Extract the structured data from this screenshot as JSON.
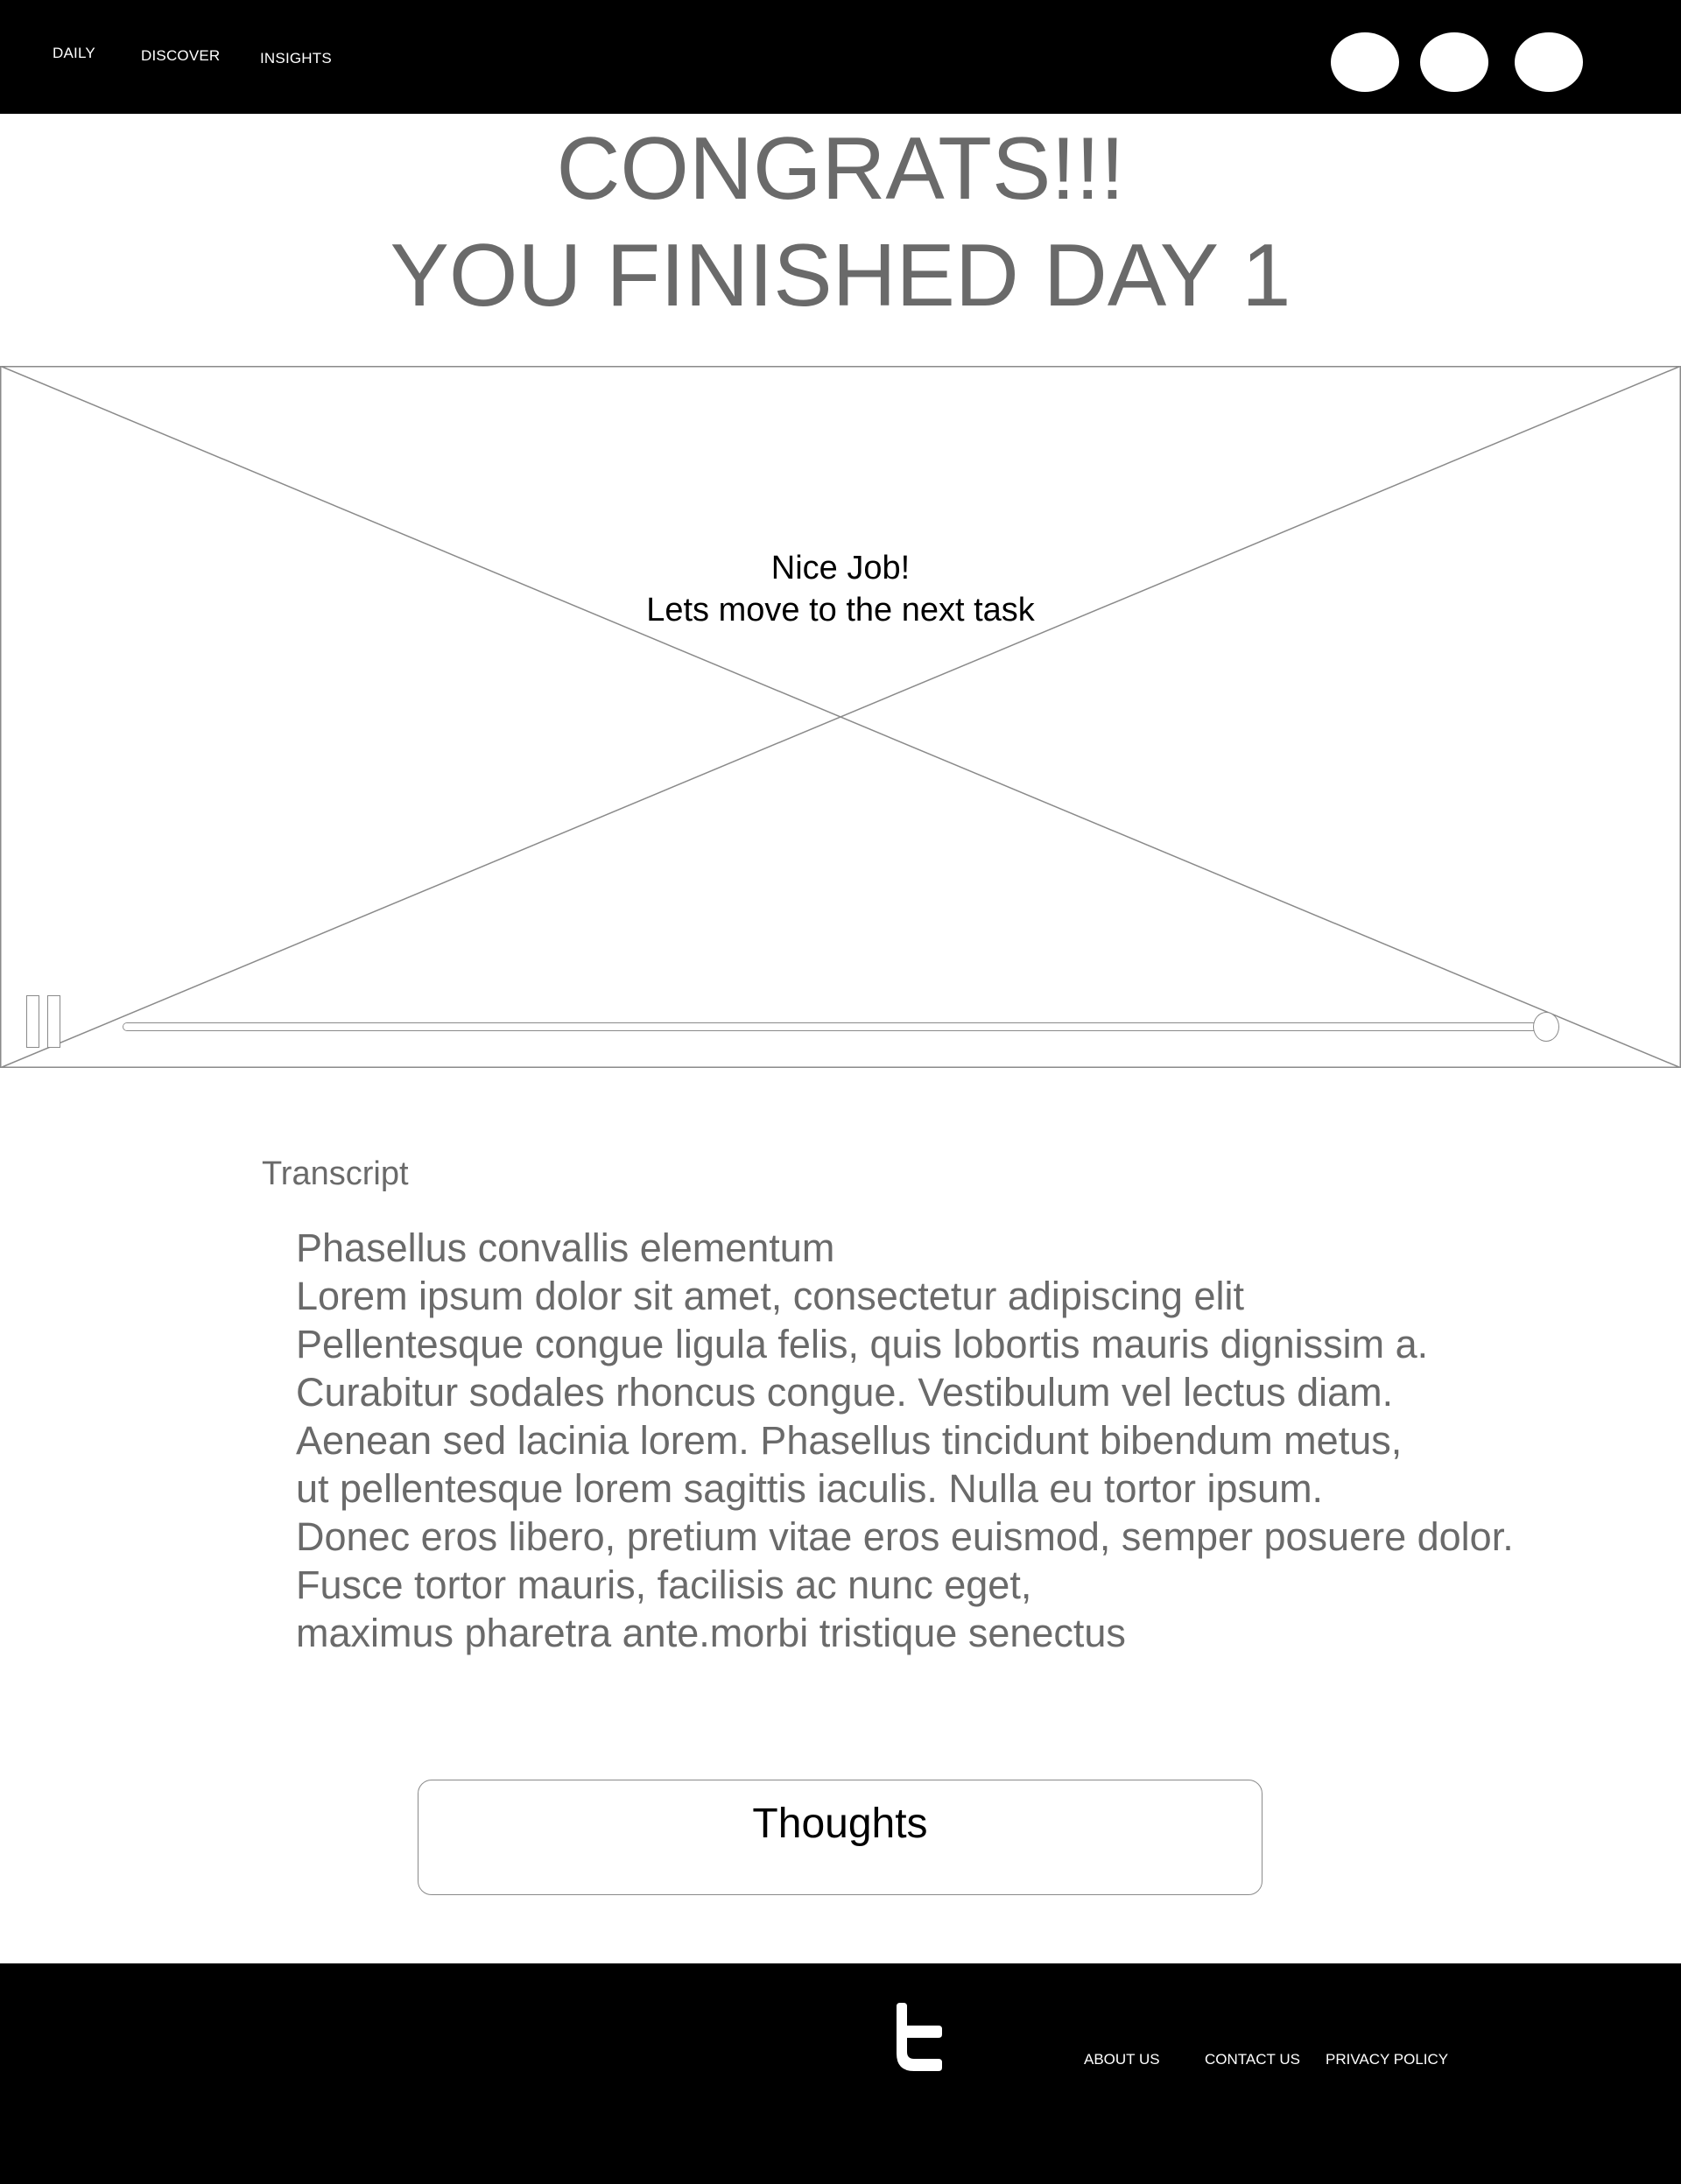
{
  "nav": {
    "items": [
      {
        "label": "DAILY"
      },
      {
        "label": "DISCOVER"
      },
      {
        "label": "INSIGHTS"
      }
    ]
  },
  "headline": {
    "line1": "CONGRATS!!!",
    "line2": "YOU FINISHED DAY 1"
  },
  "video": {
    "message_line1": "Nice Job!",
    "message_line2": "Lets move to the next task",
    "progress": 1.0,
    "state": "playing"
  },
  "transcript": {
    "heading": "Transcript",
    "lines": [
      "Phasellus convallis elementum",
      "Lorem ipsum dolor sit amet, consectetur adipiscing elit",
      "Pellentesque congue ligula felis, quis lobortis mauris dignissim a.",
      "Curabitur sodales rhoncus congue. Vestibulum vel lectus diam.",
      "Aenean sed lacinia lorem. Phasellus tincidunt bibendum metus,",
      "ut pellentesque lorem sagittis iaculis. Nulla eu tortor ipsum.",
      "Donec eros libero, pretium vitae eros euismod, semper posuere dolor.",
      "Fusce tortor mauris, facilisis ac nunc eget,",
      "maximus pharetra ante.morbi tristique senectus"
    ]
  },
  "thoughts": {
    "label": "Thoughts"
  },
  "footer": {
    "links": [
      {
        "label": "ABOUT US"
      },
      {
        "label": "CONTACT US"
      },
      {
        "label": "PRIVACY POLICY"
      }
    ],
    "social_icon": "twitter-icon"
  },
  "colors": {
    "bar_background": "#000000",
    "heading_text": "#6a6a6a",
    "placeholder_stroke": "#8a8a8a"
  }
}
